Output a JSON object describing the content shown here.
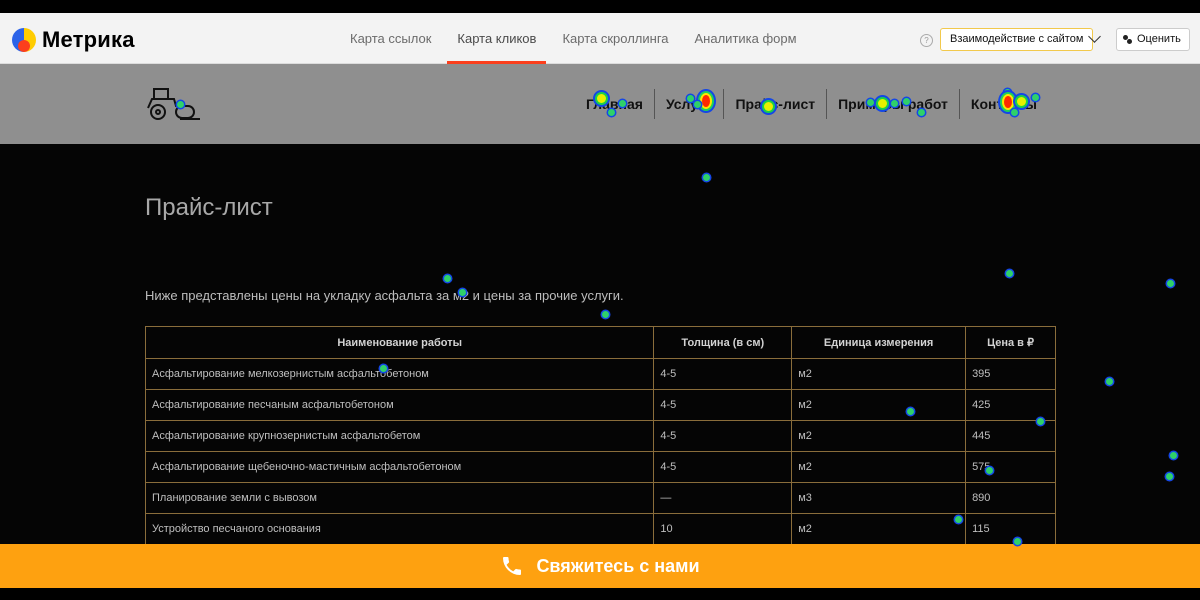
{
  "metrika": {
    "logo_text": "Метрика",
    "tabs": [
      {
        "label": "Карта ссылок",
        "active": false
      },
      {
        "label": "Карта кликов",
        "active": true
      },
      {
        "label": "Карта скроллинга",
        "active": false
      },
      {
        "label": "Аналитика форм",
        "active": false
      }
    ],
    "help_glyph": "?",
    "interaction_button": "Взаимодействие с сайтом",
    "rate_button": "Оценить",
    "colors": {
      "accent": "#fc3f1d",
      "button_border": "#f2c94c"
    }
  },
  "site": {
    "nav": [
      "Главная",
      "Услуги",
      "Прайс-лист",
      "Примеры работ",
      "Контакты"
    ],
    "page_title": "Прайс-лист",
    "intro": "Ниже представлены цены на укладку асфальта за м2 и цены за прочие услуги.",
    "table": {
      "headers": [
        "Наименование работы",
        "Толщина (в см)",
        "Единица измерения",
        "Цена в ₽"
      ],
      "rows": [
        [
          "Асфальтирование мелкозернистым асфальтобетоном",
          "4-5",
          "м2",
          "395"
        ],
        [
          "Асфальтирование песчаным асфальтобетоном",
          "4-5",
          "м2",
          "425"
        ],
        [
          "Асфальтирование крупнозернистым асфальтобетом",
          "4-5",
          "м2",
          "445"
        ],
        [
          "Асфальтирование щебеночно-мастичным асфальтобетоном",
          "4-5",
          "м2",
          "575"
        ],
        [
          "Планирование земли с вывозом",
          "—",
          "м3",
          "890"
        ],
        [
          "Устройство песчаного основания",
          "10",
          "м2",
          "115"
        ]
      ]
    },
    "contact_button": "Свяжитесь с нами",
    "colors": {
      "contact_bar": "#fea110",
      "table_border": "#8a6d3b"
    }
  }
}
